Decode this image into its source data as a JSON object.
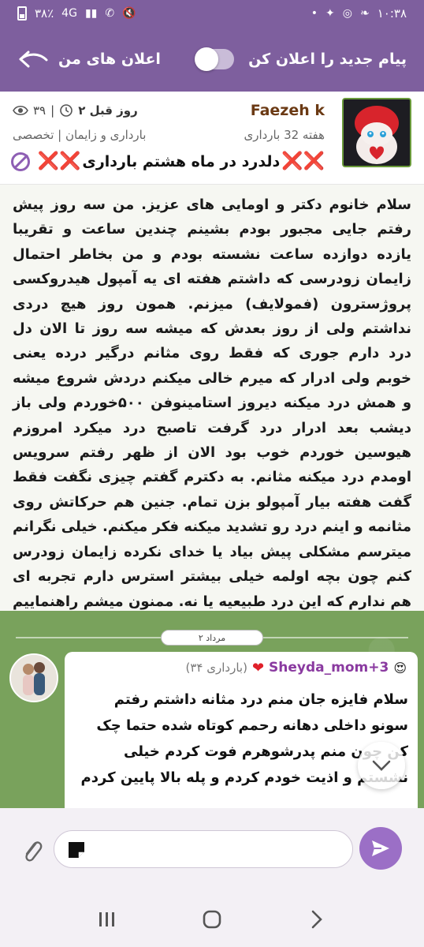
{
  "status_bar": {
    "time": "۱۰:۳۸",
    "battery": "۳۸٪",
    "network_4g": "4G",
    "network_volte": "Vo) LTE1"
  },
  "header": {
    "my_ads_label": "اعلان های من",
    "notify_label": "پیام جدید را اعلان کن",
    "notify_enabled": false
  },
  "post": {
    "author": "Faezeh k",
    "time_ago": "۲ روز قبل",
    "views": "۳۹",
    "pregnancy_week": "هفته 32 بارداری",
    "category": "بارداری و زایمان | تخصصی",
    "title": "دلدرد در ماه هشتم بارداری",
    "body": "سلام خانوم دکتر و اومایی های عزیز. من سه روز پیش رفتم جایی مجبور بودم بشینم چندین ساعت و تقریبا یازده دوازده ساعت نشسته بودم و من بخاطر احتمال زایمان زودرسی که داشتم هفته ای یه آمپول هیدروکسی پروژسترون (فمولایف) میزنم. همون روز هیچ دردی نداشتم ولی از روز بعدش که میشه سه روز  تا الان دل درد دارم جوری که فقط روی مثانم درگیر درده یعنی خوبم ولی ادرار که میرم خالی میکنم دردش شروع میشه و همش درد میکنه دیروز استامینوفن ۵۰۰خوردم ولی باز دیشب بعد ادرار درد گرفت تاصبح درد میکرد امروزم هیوسین خوردم خوب بود الان از ظهر رفتم سرویس اومدم درد میکنه مثانم. به دکترم گفتم چیزی نگفت فقط گفت هفته بیار آمپولو بزن تمام. جنین هم حرکاتش روی مثانمه و اینم درد رو تشدید میکنه فکر میکنم. خیلی نگرانم میترسم مشکلی پیش بیاد یا خدای نکرده زایمان زودرس کنم چون بچه اولمه خیلی بیشتر استرس دارم تجربه ای هم ندارم که این درد طبیعیه یا نه. ممنون میشم راهنماییم کنید. بعد چند روز پیش آزمایش ادرار دادم عفونت ندارم و دفع پروتئین ندارم."
  },
  "chat": {
    "date_label": "۲ مرداد",
    "reply": {
      "author": "Sheyda_mom+3",
      "tag": "(۳۴ بارداری)",
      "text": "سلام فایزه جان منم درد مثانه داشتم رفتم سونو داخلی دهانه رحمم کوتاه شده حتما چک کن چون منم پدرشوهرم فوت کردم خیلی نشستم و اذیت خودم کردم و پله بالا پایین کردم"
    }
  },
  "composer": {
    "placeholder": ""
  },
  "colors": {
    "header": "#7e5f9e",
    "author": "#6b3a14",
    "reply_author": "#8a3aa0",
    "send": "#9b6fc6",
    "chat_bg": "#79a25c"
  }
}
